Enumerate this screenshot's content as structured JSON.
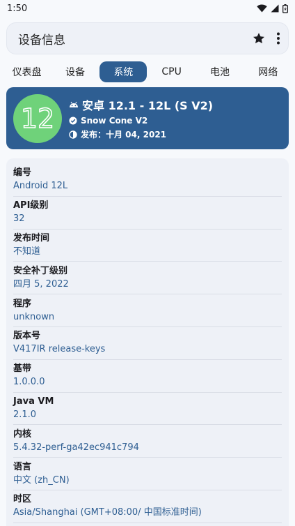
{
  "status": {
    "time": "1:50"
  },
  "appbar": {
    "title": "设备信息"
  },
  "tabs": [
    {
      "label": "仪表盘"
    },
    {
      "label": "设备"
    },
    {
      "label": "系统"
    },
    {
      "label": "CPU"
    },
    {
      "label": "电池"
    },
    {
      "label": "网络"
    }
  ],
  "hero": {
    "badge_number": "12",
    "title": "安卓 12.1 - 12L (S V2)",
    "codename": "Snow Cone V2",
    "release": "发布：十月 04, 2021"
  },
  "info": [
    {
      "label": "编号",
      "value": "Android 12L"
    },
    {
      "label": "API级别",
      "value": "32"
    },
    {
      "label": "发布时间",
      "value": "不知道"
    },
    {
      "label": "安全补丁级别",
      "value": "四月 5, 2022"
    },
    {
      "label": "程序",
      "value": "unknown"
    },
    {
      "label": "版本号",
      "value": "V417IR release-keys"
    },
    {
      "label": "基带",
      "value": "1.0.0.0"
    },
    {
      "label": "Java VM",
      "value": "2.1.0"
    },
    {
      "label": "内核",
      "value": "5.4.32-perf-ga42ec941c794"
    },
    {
      "label": "语言",
      "value": "中文 (zh_CN)"
    },
    {
      "label": "时区",
      "value": "Asia/Shanghai (GMT+08:00/ 中国标准时间)"
    }
  ],
  "colors": {
    "accent": "#2e5e92",
    "badge": "#6fd27a"
  }
}
